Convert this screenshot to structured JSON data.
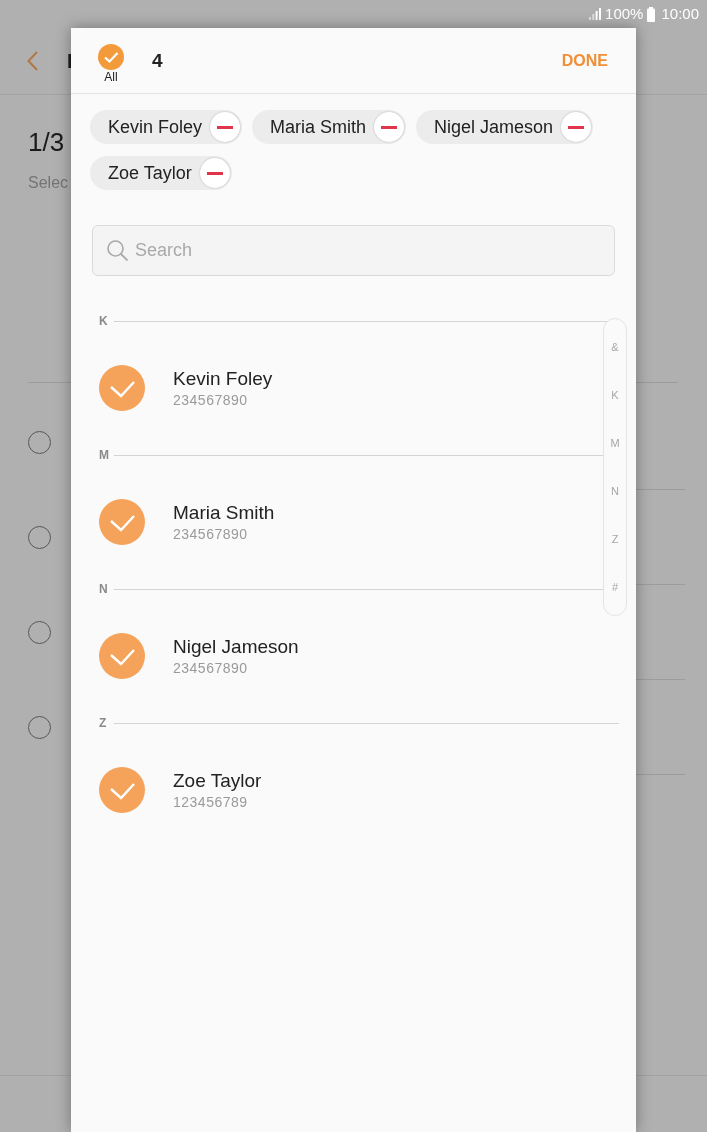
{
  "status_bar": {
    "battery": "100%",
    "time": "10:00"
  },
  "background_screen": {
    "title": "I",
    "counter": "1/3",
    "subtitle": "Selec",
    "radio_buttons": [
      {
        "selected": false
      },
      {
        "selected": false
      },
      {
        "selected": false
      },
      {
        "selected": false
      }
    ]
  },
  "dialog": {
    "select_all": {
      "label": "All",
      "checked": true
    },
    "count": "4",
    "done_button": "DONE",
    "chips": [
      "Kevin Foley",
      "Maria Smith",
      "Nigel Jameson",
      "Zoe Taylor"
    ],
    "search": {
      "placeholder": "Search"
    },
    "sections": [
      {
        "letter": "K",
        "contacts": [
          {
            "name": "Kevin Foley",
            "number": "234567890",
            "selected": true
          }
        ]
      },
      {
        "letter": "M",
        "contacts": [
          {
            "name": "Maria Smith",
            "number": "234567890",
            "selected": true
          }
        ]
      },
      {
        "letter": "N",
        "contacts": [
          {
            "name": "Nigel Jameson",
            "number": "234567890",
            "selected": true
          }
        ]
      },
      {
        "letter": "Z",
        "contacts": [
          {
            "name": "Zoe Taylor",
            "number": "123456789",
            "selected": true
          }
        ]
      }
    ],
    "index": [
      "&",
      "K",
      "M",
      "N",
      "Z",
      "#"
    ]
  }
}
